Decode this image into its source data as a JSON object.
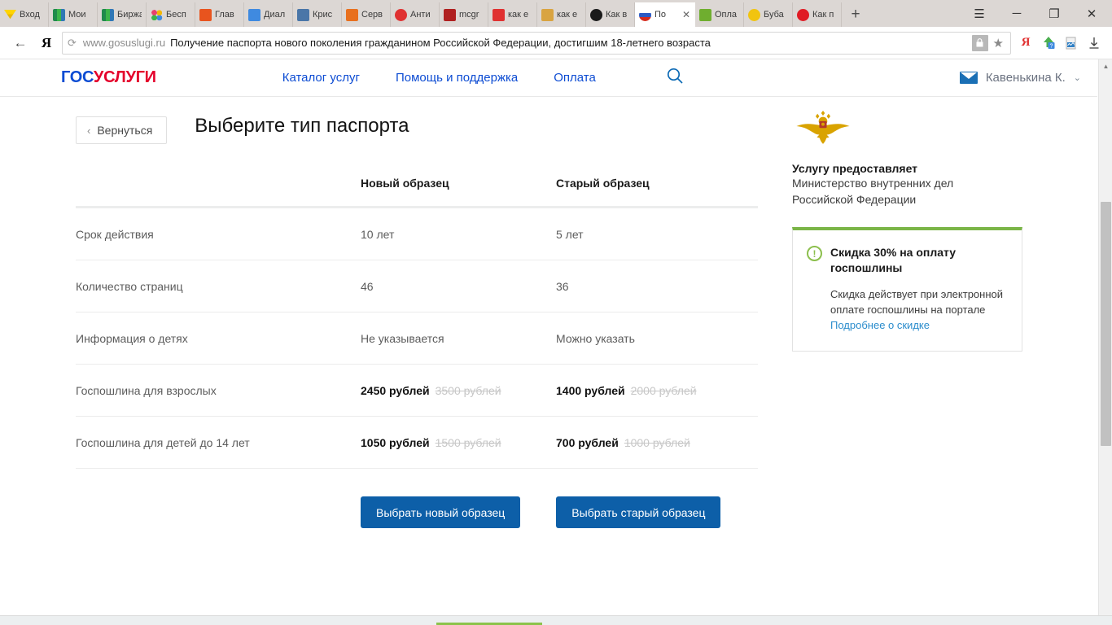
{
  "browser": {
    "tabs": [
      {
        "label": "Вход",
        "icon": "yandex-mail-icon",
        "color": "#ffd400",
        "active": false
      },
      {
        "label": "Мои",
        "icon": "stripes-icon",
        "color": "#2f9e44",
        "active": false
      },
      {
        "label": "Биржа",
        "icon": "stripes-icon",
        "color": "#2f9e44",
        "active": false
      },
      {
        "label": "Бесп",
        "icon": "dots-icon",
        "color": "#4aa3df",
        "active": false
      },
      {
        "label": "Глав",
        "icon": "fox-icon",
        "color": "#e8541e",
        "active": false
      },
      {
        "label": "Диал",
        "icon": "chat-icon",
        "color": "#3f8ae0",
        "active": false
      },
      {
        "label": "Крис",
        "icon": "vk-icon",
        "color": "#4a76a8",
        "active": false
      },
      {
        "label": "Серв",
        "icon": "fox-icon",
        "color": "#e8701e",
        "active": false
      },
      {
        "label": "Анти",
        "icon": "copyright-icon",
        "color": "#e03131",
        "active": false
      },
      {
        "label": "mcgr",
        "icon": "book-icon",
        "color": "#b02020",
        "active": false
      },
      {
        "label": "как е",
        "icon": "yandex-icon",
        "color": "#e03131",
        "active": false
      },
      {
        "label": "как е",
        "icon": "photo-icon",
        "color": "#d9a441",
        "active": false
      },
      {
        "label": "Как в",
        "icon": "circle-icon",
        "color": "#1a1a1a",
        "active": false
      },
      {
        "label": "По",
        "icon": "russia-flag-icon",
        "color": "#2b5ac4",
        "active": true,
        "close": "✕"
      },
      {
        "label": "Опла",
        "icon": "vimeo-icon",
        "color": "#6fae2f",
        "active": false
      },
      {
        "label": "Буба",
        "icon": "play-yellow-icon",
        "color": "#f1c40f",
        "active": false
      },
      {
        "label": "Как п",
        "icon": "youtube-icon",
        "color": "#e01b24",
        "active": false
      }
    ],
    "new_tab_label": "+",
    "window_controls": {
      "menu": "☰",
      "minimize": "─",
      "restore": "❐",
      "close": "✕"
    },
    "nav": {
      "back": "←",
      "yandex_mark": "Я",
      "reload": "⟳",
      "url_domain": "www.gosuslugi.ru",
      "url_title": "Получение паспорта нового поколения гражданином Российской Федерации, достигшим 18-летнего возраста",
      "lock": "🔒",
      "bookmark_star": "★",
      "extensions": [
        "yandex-ext-icon",
        "download-manager-icon",
        "print-preview-icon",
        "downloads-icon"
      ]
    }
  },
  "site_header": {
    "logo_part1": "ГОС",
    "logo_part2": "УСЛУГИ",
    "nav_items": [
      {
        "label": "Каталог услуг"
      },
      {
        "label": "Помощь и поддержка"
      },
      {
        "label": "Оплата"
      }
    ],
    "search_icon": "search-icon",
    "user_name": "Кавенькина К.",
    "user_chevron": "⌄",
    "mail_icon": "mail-icon"
  },
  "main": {
    "back_button": "Вернуться",
    "back_carat": "‹",
    "title": "Выберите тип паспорта",
    "table": {
      "columns": [
        "",
        "Новый образец",
        "Старый образец"
      ],
      "rows": [
        {
          "label": "Срок действия",
          "new": {
            "value": "10 лет"
          },
          "old": {
            "value": "5 лет"
          }
        },
        {
          "label": "Количество страниц",
          "new": {
            "value": "46"
          },
          "old": {
            "value": "36"
          }
        },
        {
          "label": "Информация о детях",
          "new": {
            "value": "Не указывается"
          },
          "old": {
            "value": "Можно указать"
          }
        },
        {
          "label": "Госпошлина для взрослых",
          "new": {
            "value": "2450 рублей",
            "old_price": "3500 рублей"
          },
          "old": {
            "value": "1400 рублей",
            "old_price": "2000 рублей"
          }
        },
        {
          "label": "Госпошлина для детей до 14 лет",
          "new": {
            "value": "1050 рублей",
            "old_price": "1500 рублей"
          },
          "old": {
            "value": "700 рублей",
            "old_price": "1000 рублей"
          }
        }
      ]
    },
    "buttons": {
      "new_sample": "Выбрать новый образец",
      "old_sample": "Выбрать старый образец"
    }
  },
  "sidebar": {
    "emblem_icon": "mvd-emblem-icon",
    "provider_heading": "Услугу предоставляет",
    "provider_line1": "Министерство внутренних дел",
    "provider_line2": "Российской Федерации",
    "promo": {
      "icon": "exclamation-circle-icon",
      "icon_glyph": "!",
      "title": "Скидка 30% на оплату госпошлины",
      "body": "Скидка действует при электронной оплате госпошлины на портале",
      "link": "Подробнее о скидке",
      "accent_color": "#7ab547"
    }
  },
  "colors": {
    "brand_blue": "#0d4cd3",
    "brand_red": "#e4002b",
    "button_blue": "#0d5fa8",
    "link_blue": "#2a8ccc",
    "promo_green": "#7ab547"
  }
}
